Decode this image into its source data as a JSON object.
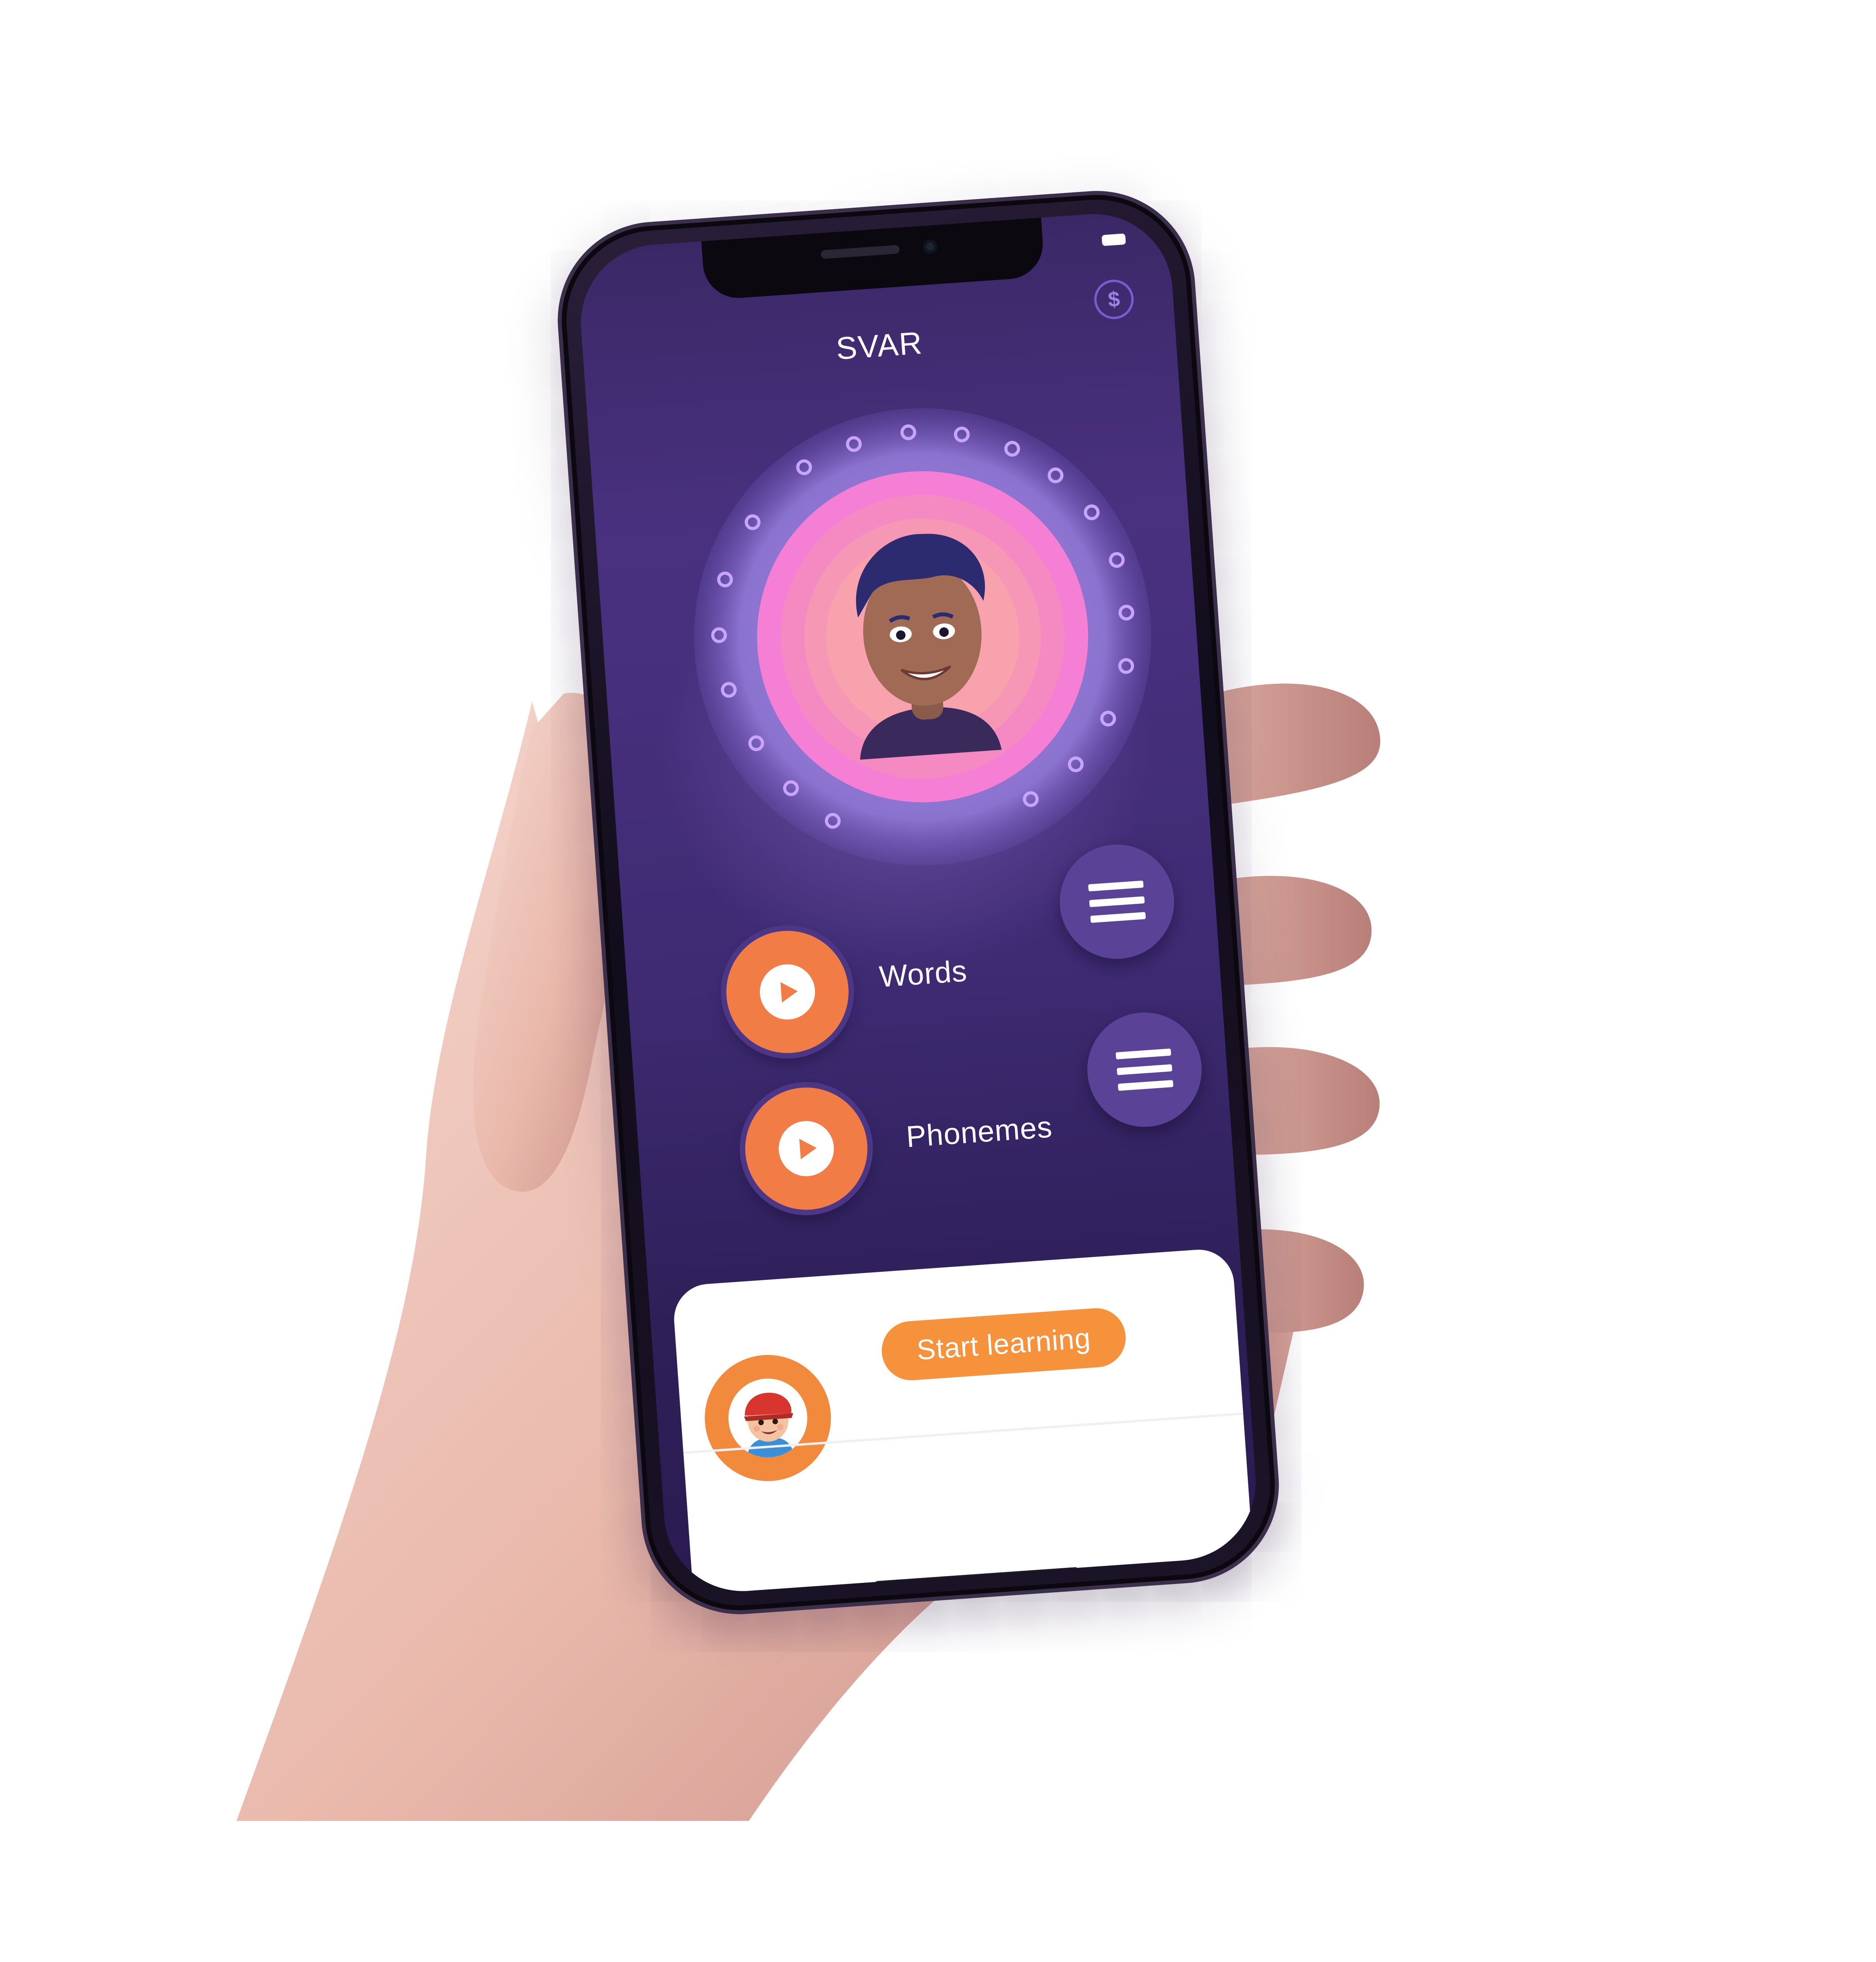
{
  "app": {
    "title": "SVAR",
    "coin_symbol": "$"
  },
  "exercises": [
    {
      "label": "Words"
    },
    {
      "label": "Phonemes"
    }
  ],
  "bottom_sheet": {
    "start_label": "Start learning"
  },
  "colors": {
    "accent_orange": "#f27c45",
    "button_orange": "#f6923c",
    "screen_purple": "#3e2b73",
    "menu_purple": "#5a4296",
    "halo_pink": "#f47fd4"
  },
  "icons": {
    "coin": "dollar-coin-icon",
    "play": "play-icon",
    "menu": "hamburger-menu-icon",
    "tutor_avatar": "tutor-avatar",
    "kid_avatar": "kid-avatar"
  }
}
